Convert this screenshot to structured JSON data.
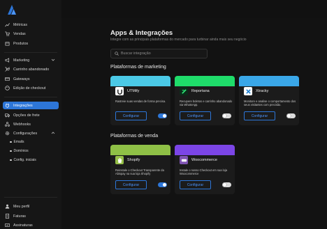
{
  "sidebar": {
    "items": [
      {
        "label": "Métricas",
        "icon": "chart-icon"
      },
      {
        "label": "Vendas",
        "icon": "cart-icon"
      },
      {
        "label": "Produtos",
        "icon": "box-icon"
      },
      {
        "label": "Marketing",
        "icon": "megaphone-icon"
      },
      {
        "label": "Carrinho abandonado",
        "icon": "cart-off-icon"
      },
      {
        "label": "Gateways",
        "icon": "card-icon"
      },
      {
        "label": "Edição de checkout",
        "icon": "palette-icon"
      },
      {
        "label": "Integrações",
        "icon": "plug-icon"
      },
      {
        "label": "Opções de frete",
        "icon": "truck-icon"
      },
      {
        "label": "Webhooks",
        "icon": "webhook-icon"
      },
      {
        "label": "Configurações",
        "icon": "gear-icon"
      }
    ],
    "sub_items": [
      "Emails",
      "Domínios",
      "Config. iniciais"
    ],
    "bottom_items": [
      {
        "label": "Meu perfil",
        "icon": "user-icon"
      },
      {
        "label": "Faturas",
        "icon": "invoice-icon"
      },
      {
        "label": "Assinaturas",
        "icon": "subscription-icon"
      }
    ]
  },
  "header": {
    "title": "Apps & Integrações",
    "subtitle": "Integre com as principais plataformas do mercado para turbinar ainda mais seu negócio"
  },
  "search": {
    "placeholder": "Buscar integração"
  },
  "sections": [
    {
      "title": "Plataformas de marketing",
      "cards": [
        {
          "name": "UTMify",
          "description": "Rastreie suas vendas de forma precisa.",
          "button": "Configurar",
          "enabled": true,
          "color": "#4bc9e6",
          "logo_bg": "#ffffff"
        },
        {
          "name": "Reportana",
          "description": "Recupere boletos e carrinho abandonado via WhatsApp.",
          "button": "Configurar",
          "enabled": false,
          "color": "#1fdc6a",
          "logo_bg": "#0c2b1a"
        },
        {
          "name": "Xtracky",
          "description": "Monitore e analise o comportamento dos seus visitantes com precisão.",
          "button": "Configurar",
          "enabled": false,
          "color": "#3aa7e8",
          "logo_bg": "#ffffff"
        }
      ]
    },
    {
      "title": "Plataformas de venda",
      "cards": [
        {
          "name": "Shopify",
          "description": "Reinstale o Checkout Transparente da Abispay na sua loja Shopify",
          "button": "Configurar",
          "enabled": true,
          "color": "#8fc046",
          "logo_bg": "#95bf47"
        },
        {
          "name": "Woocommerce",
          "description": "Instale o nosso Checkout em sua loja Woocommerce",
          "button": "Configurar",
          "enabled": false,
          "color": "#7b45e6",
          "logo_bg": "#7f54b3"
        }
      ]
    }
  ],
  "colors": {
    "accent": "#2d76d8",
    "background": "#121212"
  }
}
